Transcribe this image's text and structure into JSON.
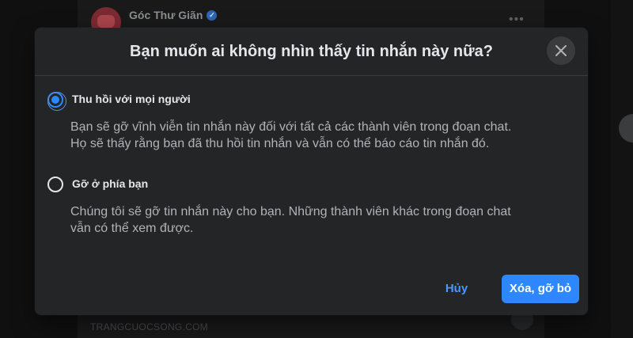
{
  "background": {
    "page_name": "Góc Thư Giãn",
    "watermark": "TRANGCUOCSONG.COM",
    "more_icon": "ellipsis-icon",
    "verified_icon": "verified-badge-icon"
  },
  "dialog": {
    "title": "Bạn muốn ai không nhìn thấy tin nhắn này nữa?",
    "close_icon": "close-icon",
    "options": [
      {
        "label": "Thu hồi với mọi người",
        "selected": true,
        "description_line1": "Bạn sẽ gỡ vĩnh viễn tin nhắn này đối với tất cả các thành viên trong đoạn chat.",
        "description_line2": "Họ sẽ thấy rằng bạn đã thu hồi tin nhắn và vẫn có thể báo cáo tin nhắn đó."
      },
      {
        "label": "Gỡ ở phía bạn",
        "selected": false,
        "description_line1": "Chúng tôi sẽ gỡ tin nhắn này cho bạn. Những thành viên khác trong đoạn chat",
        "description_line2": "vẫn có thể xem được."
      }
    ],
    "cancel_label": "Hủy",
    "confirm_label": "Xóa, gỡ bỏ"
  },
  "colors": {
    "accent": "#2d88ff",
    "dialog_bg": "#242526",
    "title_text": "#e4e6eb",
    "secondary_text": "#b0b3b8"
  }
}
